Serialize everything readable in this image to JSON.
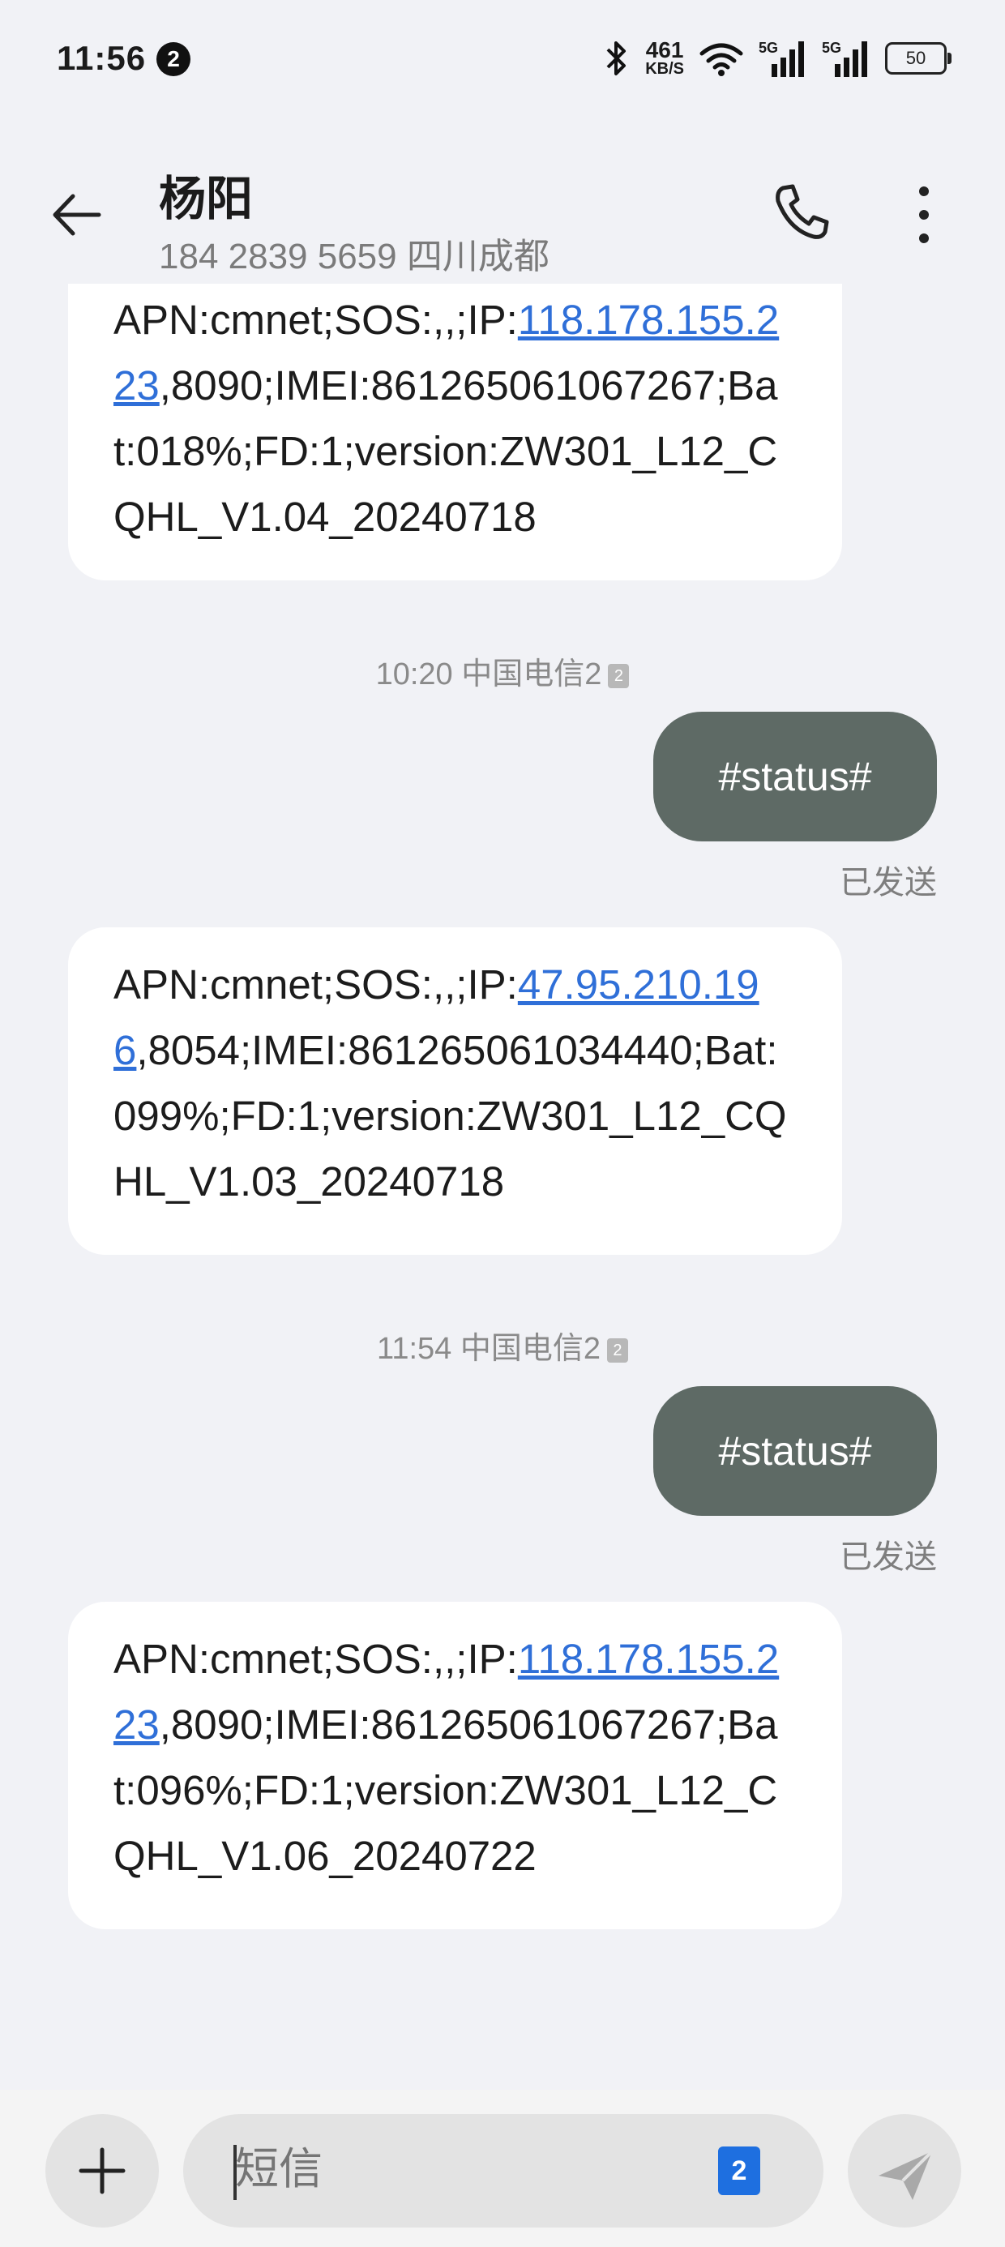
{
  "status_bar": {
    "time": "11:56",
    "notification_count": "2",
    "net_speed": "461",
    "net_unit": "KB/S",
    "sig1_label": "5G",
    "sig2_label": "5G",
    "battery": "50"
  },
  "header": {
    "name": "杨阳",
    "subtitle": "184 2839 5659  四川成都"
  },
  "messages": [
    {
      "type": "incoming",
      "pre": "APN:cmnet;SOS:,,;IP:",
      "link": "118.178.155.223",
      "post": ",8090;IMEI:861265061067267;Bat:018%;FD:1;version:ZW301_L12_CQHL_V1.04_20240718"
    },
    {
      "type": "timestamp",
      "text": "10:20 中国电信2",
      "sim": "2"
    },
    {
      "type": "outgoing",
      "text": "#status#",
      "status": "已发送"
    },
    {
      "type": "incoming",
      "pre": "APN:cmnet;SOS:,,;IP:",
      "link": "47.95.210.196",
      "post": ",8054;IMEI:861265061034440;Bat:099%;FD:1;version:ZW301_L12_CQHL_V1.03_20240718"
    },
    {
      "type": "timestamp",
      "text": "11:54 中国电信2",
      "sim": "2"
    },
    {
      "type": "outgoing",
      "text": "#status#",
      "status": "已发送"
    },
    {
      "type": "incoming",
      "pre": "APN:cmnet;SOS:,,;IP:",
      "link": "118.178.155.223",
      "post": ",8090;IMEI:861265061067267;Bat:096%;FD:1;version:ZW301_L12_CQHL_V1.06_20240722"
    }
  ],
  "composer": {
    "placeholder": "短信",
    "sim_badge": "2"
  },
  "colors": {
    "background": "#f1f2f6",
    "outgoing_bubble": "#5e6a65",
    "link": "#2f6fd8",
    "sim_badge": "#1e6fe0"
  },
  "icons": {
    "back": "arrow-left-icon",
    "call": "phone-icon",
    "more": "more-vertical-icon",
    "add": "plus-icon",
    "send": "send-icon",
    "bluetooth": "bluetooth-icon",
    "wifi": "wifi-icon"
  }
}
